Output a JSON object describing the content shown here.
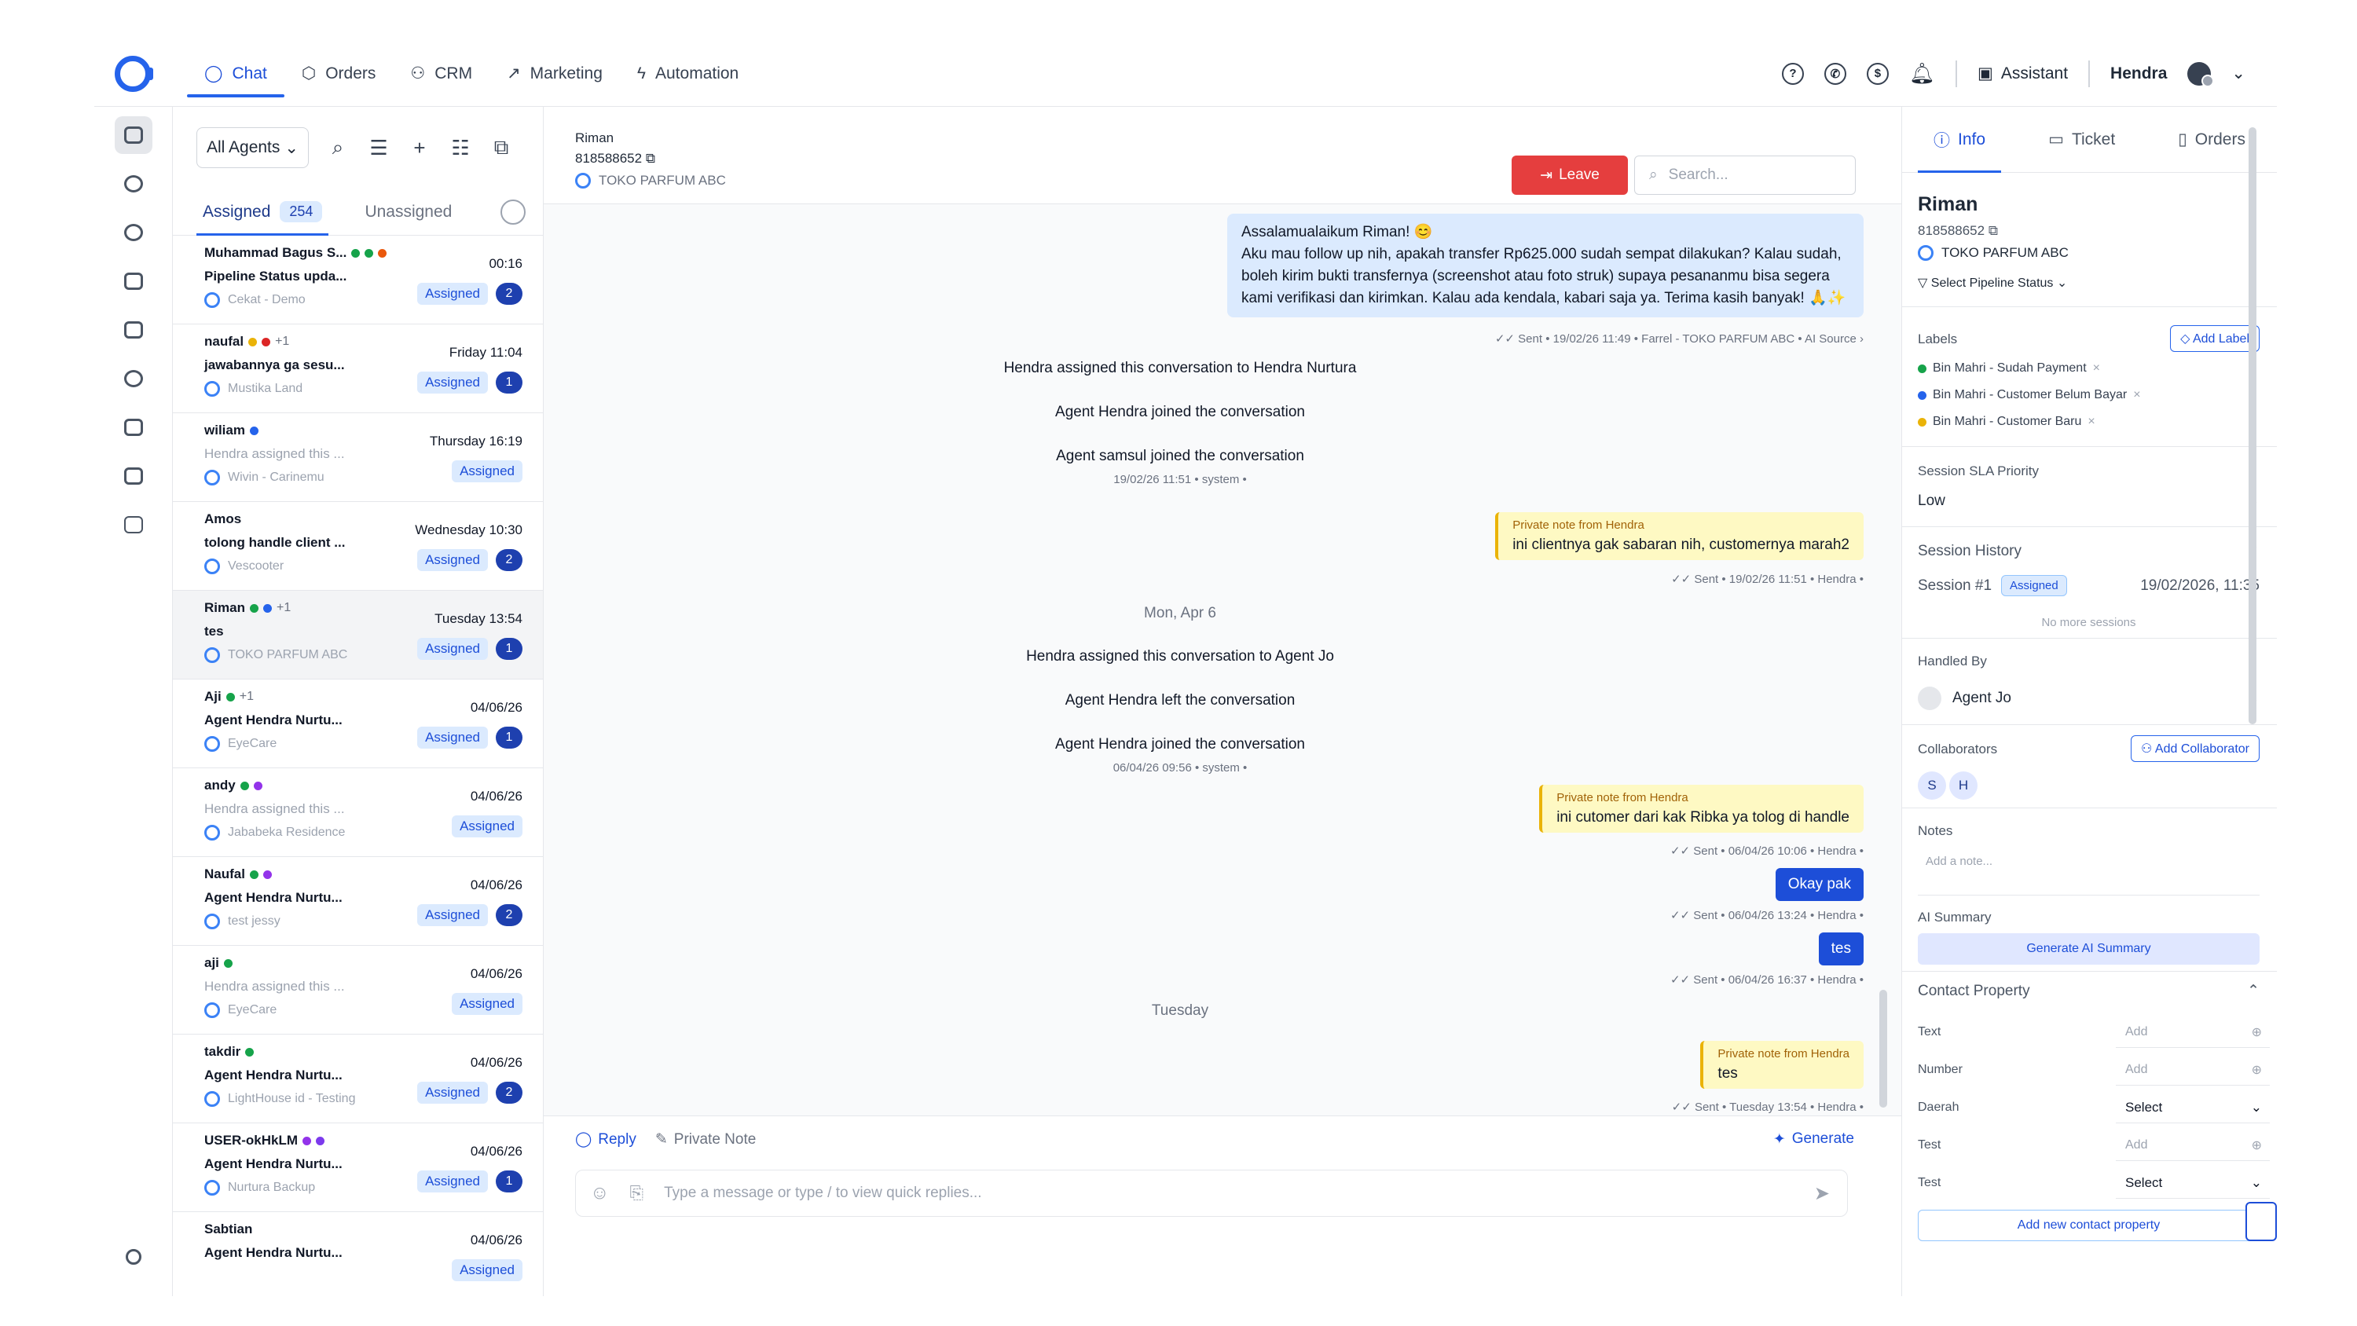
{
  "nav": {
    "tabs": [
      {
        "label": "Chat",
        "icon": "chat-icon"
      },
      {
        "label": "Orders",
        "icon": "box-icon"
      },
      {
        "label": "CRM",
        "icon": "users-icon"
      },
      {
        "label": "Marketing",
        "icon": "trend-icon"
      },
      {
        "label": "Automation",
        "icon": "bolt-icon"
      }
    ],
    "assistant": "Assistant",
    "user": "Hendra"
  },
  "list": {
    "agent_filter": "All Agents",
    "tabs": {
      "assigned": "Assigned",
      "assigned_count": "254",
      "unassigned": "Unassigned"
    },
    "items": [
      {
        "name": "Muhammad Bagus S...",
        "msg": "Pipeline Status upda...",
        "biz": "Cekat - Demo",
        "time": "00:16",
        "status": "Assigned",
        "count": "2",
        "light": false
      },
      {
        "name": "naufal",
        "plus": "+1",
        "msg": "jawabannya ga sesu...",
        "biz": "Mustika Land",
        "time": "Friday 11:04",
        "status": "Assigned",
        "count": "1",
        "light": false
      },
      {
        "name": "wiliam",
        "msg": "Hendra assigned this ...",
        "biz": "Wivin - Carinemu",
        "time": "Thursday 16:19",
        "status": "Assigned",
        "count": "",
        "light": true
      },
      {
        "name": "Amos",
        "msg": "tolong handle client ...",
        "biz": "Vescooter",
        "time": "Wednesday 10:30",
        "status": "Assigned",
        "count": "2",
        "light": false
      },
      {
        "name": "Riman",
        "plus": "+1",
        "msg": "tes",
        "biz": "TOKO PARFUM ABC",
        "time": "Tuesday 13:54",
        "status": "Assigned",
        "count": "1",
        "light": false
      },
      {
        "name": "Aji",
        "plus": "+1",
        "msg": "Agent Hendra Nurtu...",
        "biz": "EyeCare",
        "time": "04/06/26",
        "status": "Assigned",
        "count": "1",
        "light": false
      },
      {
        "name": "andy",
        "msg": "Hendra assigned this ...",
        "biz": "Jababeka Residence",
        "time": "04/06/26",
        "status": "Assigned",
        "count": "",
        "light": true
      },
      {
        "name": "Naufal",
        "msg": "Agent Hendra Nurtu...",
        "biz": "test jessy",
        "time": "04/06/26",
        "status": "Assigned",
        "count": "2",
        "light": false
      },
      {
        "name": "aji",
        "msg": "Hendra assigned this ...",
        "biz": "EyeCare",
        "time": "04/06/26",
        "status": "Assigned",
        "count": "",
        "light": true
      },
      {
        "name": "takdir",
        "msg": "Agent Hendra Nurtu...",
        "biz": "LightHouse id - Testing",
        "time": "04/06/26",
        "status": "Assigned",
        "count": "2",
        "light": false
      },
      {
        "name": "USER-okHkLM",
        "msg": "Agent Hendra Nurtu...",
        "biz": "Nurtura Backup",
        "time": "04/06/26",
        "status": "Assigned",
        "count": "1",
        "light": false
      },
      {
        "name": "Sabtian",
        "msg": "Agent Hendra Nurtu...",
        "biz": "",
        "time": "04/06/26",
        "status": "Assigned",
        "count": "",
        "light": false
      }
    ]
  },
  "chat": {
    "name": "Riman",
    "phone": "818588652",
    "biz": "TOKO PARFUM ABC",
    "leave": "Leave",
    "search_placeholder": "Search...",
    "m1": {
      "text": "Assalamualaikum Riman! 😊\nAku mau follow up nih, apakah transfer Rp625.000 sudah sempat dilakukan? Kalau sudah, boleh kirim bukti transfernya (screenshot atau foto struk) supaya pesananmu bisa segera kami verifikasi dan kirimkan. Kalau ada kendala, kabari saja ya. Terima kasih banyak! 🙏✨",
      "meta": "✓✓ Sent • 19/02/26 11:49 • Farrel - TOKO PARFUM ABC • AI Source ›"
    },
    "s1": "Hendra assigned this conversation to Hendra Nurtura",
    "s2": "Agent Hendra joined the conversation",
    "s3": "Agent samsul joined the conversation",
    "s3meta": "19/02/26 11:51 • system •",
    "n1": {
      "label": "Private note from Hendra",
      "text": "ini clientnya gak sabaran nih, customernya marah2",
      "meta": "✓✓ Sent • 19/02/26 11:51 • Hendra •"
    },
    "date1": "Mon, Apr 6",
    "s4": "Hendra assigned this conversation to Agent Jo",
    "s5": "Agent Hendra left the conversation",
    "s6": "Agent Hendra joined the conversation",
    "s6meta": "06/04/26 09:56 • system •",
    "n2": {
      "label": "Private note from Hendra",
      "text": "ini cutomer dari kak Ribka ya tolog di handle",
      "meta": "✓✓ Sent • 06/04/26 10:06 • Hendra •"
    },
    "o1": {
      "text": "Okay pak",
      "meta": "✓✓ Sent • 06/04/26 13:24 • Hendra •"
    },
    "o2": {
      "text": "tes",
      "meta": "✓✓ Sent • 06/04/26 16:37 • Hendra •"
    },
    "date2": "Tuesday",
    "n3": {
      "label": "Private note from Hendra",
      "text": "tes",
      "meta": "✓✓ Sent • Tuesday 13:54 • Hendra •"
    },
    "reply": "Reply",
    "private_note": "Private Note",
    "generate": "Generate",
    "composer_placeholder": "Type a message or type / to view quick replies..."
  },
  "info": {
    "tabs": [
      "Info",
      "Ticket",
      "Orders"
    ],
    "name": "Riman",
    "phone": "818588652",
    "biz": "TOKO PARFUM ABC",
    "pipeline": "Select Pipeline Status",
    "labels_title": "Labels",
    "add_label": "Add Label",
    "labels": [
      {
        "text": "Bin Mahri - Sudah Payment",
        "color": "#16a34a"
      },
      {
        "text": "Bin Mahri - Customer Belum Bayar",
        "color": "#2563eb"
      },
      {
        "text": "Bin Mahri - Customer Baru",
        "color": "#eab308"
      }
    ],
    "sla_title": "Session SLA Priority",
    "sla": "Low",
    "history_title": "Session History",
    "session": "Session #1",
    "session_status": "Assigned",
    "session_time": "19/02/2026, 11:35",
    "no_more": "No more sessions",
    "handled_title": "Handled By",
    "handled": "Agent Jo",
    "collab_title": "Collaborators",
    "add_collab": "Add Collaborator",
    "collab": [
      "S",
      "H"
    ],
    "notes_title": "Notes",
    "notes_placeholder": "Add a note...",
    "ai_title": "AI Summary",
    "ai_btn": "Generate AI Summary",
    "cp_title": "Contact Property",
    "props": [
      {
        "k": "Text",
        "v": "Add"
      },
      {
        "k": "Number",
        "v": "Add"
      },
      {
        "k": "Daerah",
        "v": "Select"
      },
      {
        "k": "Test",
        "v": "Add"
      },
      {
        "k": "Test",
        "v": "Select"
      }
    ],
    "add_prop": "Add new contact property"
  }
}
